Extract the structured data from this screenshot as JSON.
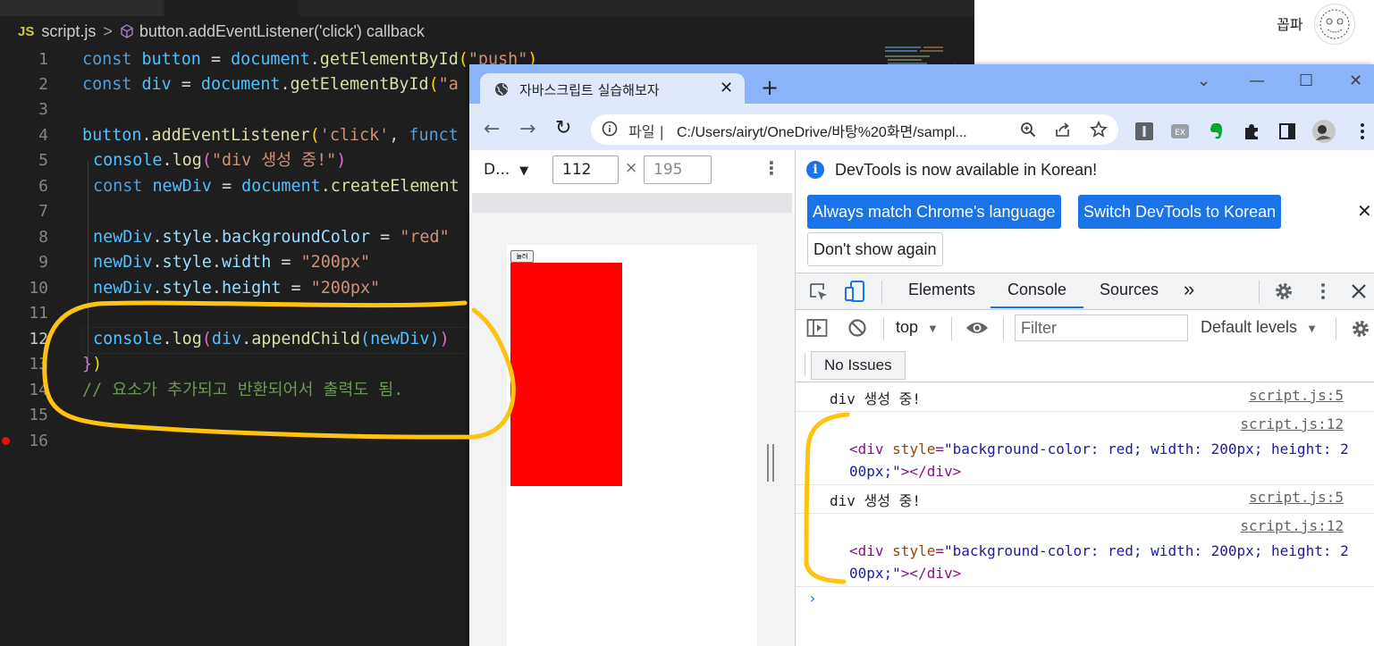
{
  "editor": {
    "breadcrumb": {
      "lang": "JS",
      "file": "script.js",
      "sep": ">",
      "symbol": "button.addEventListener('click') callback"
    },
    "line_numbers": [
      "1",
      "2",
      "3",
      "4",
      "5",
      "6",
      "7",
      "8",
      "9",
      "10",
      "11",
      "12",
      "13",
      "14",
      "15",
      "16"
    ],
    "lines": {
      "l1": {
        "a": "const",
        "b": " button",
        "c": " = ",
        "d": "document",
        "e": ".",
        "f": "getElementById",
        "g": "(",
        "h": "\"push\"",
        "i": ")"
      },
      "l2": {
        "a": "const",
        "b": " div",
        "c": " = ",
        "d": "document",
        "e": ".",
        "f": "getElementById",
        "g": "(",
        "h": "\"a"
      },
      "l4": {
        "a": "button",
        "b": ".",
        "c": "addEventListener",
        "d": "(",
        "e": "'click'",
        "f": ", ",
        "g": "funct"
      },
      "l5": {
        "a": "console",
        "b": ".",
        "c": "log",
        "d": "(",
        "e": "\"div 생성 중!\"",
        "f": ")"
      },
      "l6": {
        "a": "const",
        "b": " newDiv",
        "c": " = ",
        "d": "document",
        "e": ".",
        "f": "createElement"
      },
      "l8": {
        "a": "newDiv",
        "b": ".",
        "c": "style",
        "d": ".",
        "e": "backgroundColor",
        "f": " = ",
        "g": "\"red\""
      },
      "l9": {
        "a": "newDiv",
        "b": ".",
        "c": "style",
        "d": ".",
        "e": "width",
        "f": " = ",
        "g": "\"200px\""
      },
      "l10": {
        "a": "newDiv",
        "b": ".",
        "c": "style",
        "d": ".",
        "e": "height",
        "f": " = ",
        "g": "\"200px\""
      },
      "l12": {
        "a": "console",
        "b": ".",
        "c": "log",
        "d": "(",
        "e": "div",
        "f": ".",
        "g": "appendChild",
        "h": "(",
        "i": "newDiv",
        "j": ")",
        "k": ")"
      },
      "l13": {
        "a": "}",
        "b": ")"
      },
      "l14": {
        "a": "// 요소가 추가되고 반환되어서 출력도 됨."
      }
    }
  },
  "desktop": {
    "user_name": "꼽파"
  },
  "browser": {
    "tab_title": "자바스크립트 실습해보자",
    "tab_close": "✕",
    "new_tab": "+",
    "window_controls": [
      "⌄",
      "—",
      "☐",
      "✕"
    ],
    "nav": {
      "back": "←",
      "forward": "→",
      "reload": "↻"
    },
    "omnibox": {
      "scheme_label": "파일",
      "divider": "|",
      "url": "C:/Users/airyt/OneDrive/바탕%20화면/sampl..."
    },
    "device_toolbar": {
      "preset": "D...",
      "preset_caret": "▼",
      "width": "112",
      "times": "×",
      "height_placeholder": "195",
      "more": "⋮"
    },
    "page": {
      "button_label": "눌러"
    }
  },
  "devtools": {
    "infobar": {
      "message": "DevTools is now available in Korean!",
      "btn_match": "Always match Chrome's language",
      "btn_switch": "Switch DevTools to Korean",
      "btn_dont_show": "Don't show again",
      "close": "✕"
    },
    "tabs": {
      "elements": "Elements",
      "console": "Console",
      "sources": "Sources",
      "more": "»"
    },
    "console_bar": {
      "context": "top",
      "context_caret": "▼",
      "filter_placeholder": "Filter",
      "levels": "Default levels",
      "levels_caret": "▼"
    },
    "issues_label": "No Issues",
    "messages": [
      {
        "text": "div 생성 중!",
        "source": "script.js:5"
      },
      {
        "source": "script.js:12",
        "html": {
          "open": "<div ",
          "attr": "style",
          "eq": "=",
          "val": "\"background-color: red; width: 200px; height: 200px;\"",
          "close": "></div>"
        }
      },
      {
        "text": "div 생성 중!",
        "source": "script.js:5"
      },
      {
        "source": "script.js:12",
        "html": {
          "open": "<div ",
          "attr": "style",
          "eq": "=",
          "val": "\"background-color: red; width: 200px; height: 200px;\"",
          "close": "></div>"
        }
      }
    ],
    "prompt": "›"
  },
  "colors": {
    "annotation": "#ffc20e",
    "red_div": "#ff0000",
    "chrome_accent": "#1a73e8",
    "tabbar": "#8ab4f8"
  }
}
